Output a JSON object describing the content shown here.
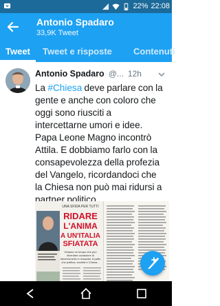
{
  "status_bar": {
    "battery": "22%",
    "time": "22:08",
    "icons": [
      "notification-icon",
      "signal-icon",
      "wifi-icon",
      "battery-icon"
    ]
  },
  "app_bar": {
    "title": "Antonio Spadaro",
    "subtitle": "33,9K Tweet"
  },
  "tabs": [
    {
      "label": "Tweet",
      "active": true
    },
    {
      "label": "Tweet e risposte",
      "active": false
    },
    {
      "label": "Contenuti",
      "active": false
    }
  ],
  "tweet": {
    "author": "Antonio Spadaro",
    "handle": "@...",
    "time": "12h",
    "text_lines": [
      "La #Chiesa deve parlare con la",
      "gente e anche con coloro che",
      "oggi sono riusciti a",
      "intercettarne umori e idee.",
      "Papa Leone Magno incontrò",
      "Attila. E dobbiamo farlo con la",
      "consapevolezza della profezia",
      "del Vangelo, ricordandoci che",
      "la Chiesa non può mai ridursi a",
      "partner politico."
    ],
    "text_prefix": "La ",
    "hashtag": "#Chiesa",
    "text_after_hashtag": " deve parlare con la",
    "media": {
      "kicker": "UNA SFIDA PER TUTTI",
      "headline_1": "RIDARE",
      "headline_2": "L'ANIMA",
      "headline_3": "A UN'ITALIA",
      "headline_4": "SFIATATA",
      "deck": "Viviamo un tempo che può diventare occasione di discernimento e rinascita. A patto che politica, società e Chiesa...",
      "photo_caption": "Il padre Antonio Spadaro"
    }
  },
  "colors": {
    "twitter_blue": "#1da1f2",
    "status_bar": "#1b6a9a",
    "headline_red": "#d0112b"
  }
}
